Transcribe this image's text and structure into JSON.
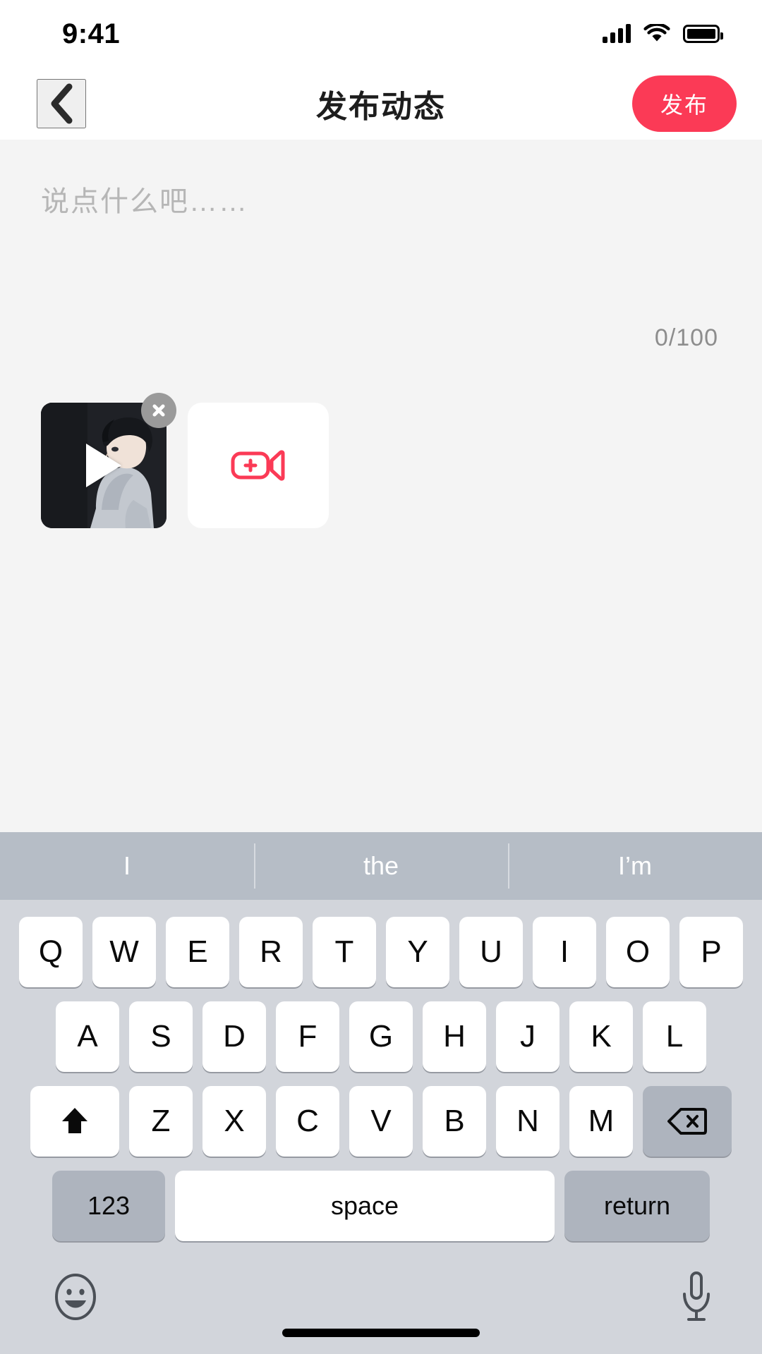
{
  "status_bar": {
    "time": "9:41",
    "signal_icon": "signal-bars-icon",
    "wifi_icon": "wifi-icon",
    "battery_icon": "battery-full-icon"
  },
  "nav_bar": {
    "back_icon": "chevron-left-icon",
    "title": "发布动态",
    "publish_label": "发布",
    "publish_color": "#fb3a56"
  },
  "composer": {
    "placeholder": "说点什么吧……",
    "value": "",
    "counter": "0/100",
    "max_length": 100
  },
  "media": {
    "video_thumbnail": {
      "play_icon": "play-triangle-icon",
      "remove_icon": "close-x-icon"
    },
    "add_button": {
      "icon": "add-video-camera-icon",
      "icon_color": "#fb3a56"
    }
  },
  "keyboard": {
    "suggestions": [
      "I",
      "the",
      "I’m"
    ],
    "row1": [
      "Q",
      "W",
      "E",
      "R",
      "T",
      "Y",
      "U",
      "I",
      "O",
      "P"
    ],
    "row2": [
      "A",
      "S",
      "D",
      "F",
      "G",
      "H",
      "J",
      "K",
      "L"
    ],
    "row3": [
      "Z",
      "X",
      "C",
      "V",
      "B",
      "N",
      "M"
    ],
    "shift_icon": "shift-arrow-icon",
    "delete_icon": "backspace-icon",
    "numbers_label": "123",
    "space_label": "space",
    "return_label": "return",
    "emoji_icon": "emoji-smiley-icon",
    "mic_icon": "microphone-icon"
  }
}
